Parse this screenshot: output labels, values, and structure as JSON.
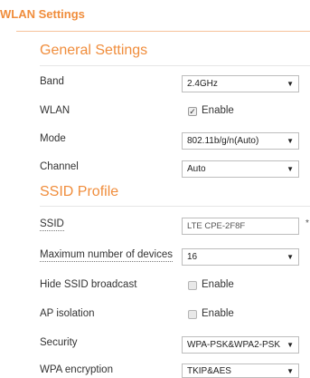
{
  "page": {
    "title": "WLAN Settings"
  },
  "general": {
    "title": "General Settings",
    "band": {
      "label": "Band",
      "value": "2.4GHz"
    },
    "wlan": {
      "label": "WLAN",
      "checkbox_label": "Enable",
      "checked": true
    },
    "mode": {
      "label": "Mode",
      "value": "802.11b/g/n(Auto)"
    },
    "channel": {
      "label": "Channel",
      "value": "Auto"
    }
  },
  "ssid_profile": {
    "title": "SSID Profile",
    "ssid": {
      "label": "SSID",
      "value": "LTE CPE-2F8F",
      "required_mark": "*"
    },
    "max_devices": {
      "label": "Maximum number of devices",
      "value": "16"
    },
    "hide_ssid": {
      "label": "Hide SSID broadcast",
      "checkbox_label": "Enable",
      "checked": false
    },
    "ap_isolation": {
      "label": "AP isolation",
      "checkbox_label": "Enable",
      "checked": false
    },
    "security": {
      "label": "Security",
      "value": "WPA-PSK&WPA2-PSK"
    },
    "wpa_encryption": {
      "label": "WPA encryption",
      "value": "TKIP&AES"
    }
  },
  "icons": {
    "dropdown": "chevron-down-icon",
    "check": "check-icon"
  },
  "colors": {
    "accent": "#f08d3c",
    "rule": "#f6c29a"
  }
}
